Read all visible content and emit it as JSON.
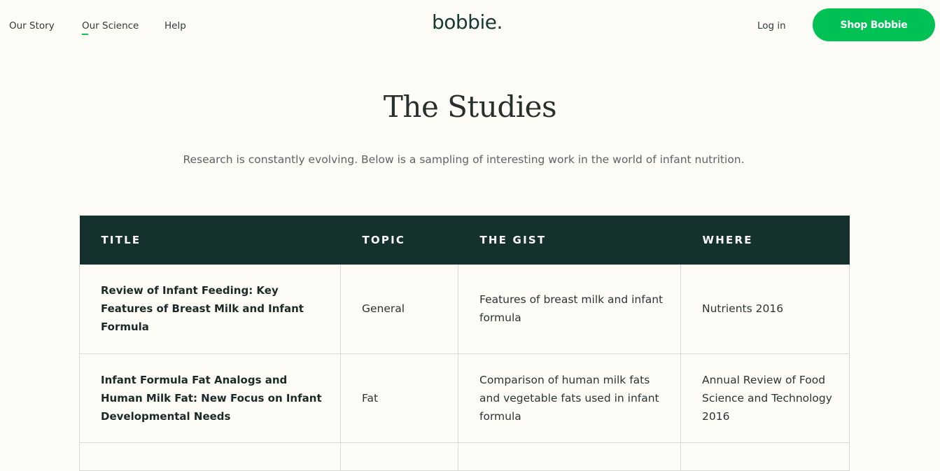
{
  "nav": {
    "links": [
      "Our Story",
      "Our Science",
      "Help"
    ],
    "logo": "bobbie",
    "login": "Log in",
    "shop": "Shop Bobbie"
  },
  "main": {
    "title": "The Studies",
    "subtitle": "Research is constantly evolving. Below is a sampling of interesting work in the world of infant nutrition."
  },
  "table": {
    "headers": [
      "TITLE",
      "TOPIC",
      "THE GIST",
      "WHERE"
    ],
    "rows": [
      [
        "Review of Infant Feeding: Key Features of Breast Milk and Infant Formula",
        "General",
        "Features of breast milk and infant formula",
        "Nutrients 2016"
      ],
      [
        "Infant Formula Fat Analogs and Human Milk Fat: New Focus on Infant Developmental Needs",
        "Fat",
        "Comparison of human milk fats and vegetable fats used in infant formula",
        "Annual Review of Food Science and Technology 2016"
      ],
      [
        "",
        "",
        "",
        ""
      ]
    ]
  }
}
